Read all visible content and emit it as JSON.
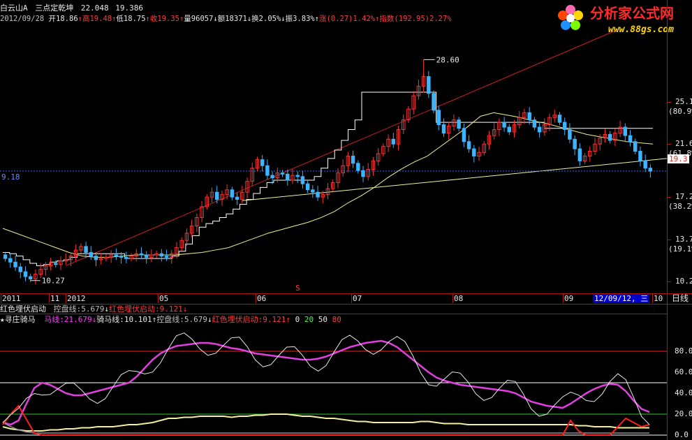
{
  "stock": {
    "name": "白云山A",
    "formula": "三点定乾坤",
    "v1": "22.048",
    "v2": "19.386"
  },
  "quote": {
    "date": "2012/09/28",
    "open": "开18.86",
    "high": "高19.48",
    "low": "低18.75",
    "close": "收19.35",
    "vol": "量96057",
    "amt": "额18371",
    "turn": "换2.05%",
    "amp": "振3.83%",
    "chg": "涨(0.27)1.42%",
    "idx": "指数(192.95)2.27%"
  },
  "annotations": {
    "peak": "28.60",
    "trough": "10.27",
    "hline": "9.18",
    "price_tag": "19.3",
    "signal": "S"
  },
  "price_axis": [
    {
      "v": "25.1",
      "p": "(80.9%)"
    },
    {
      "v": "21.6",
      "p": "(61.8%)"
    },
    {
      "v": "17.2",
      "p": "(38.2%)"
    },
    {
      "v": "13.7",
      "p": "(19.1%)"
    },
    {
      "v": "10.2",
      "p": ""
    }
  ],
  "time_axis": [
    "2011",
    "11",
    "2012",
    "05",
    "06",
    "07",
    "08",
    "09",
    "10"
  ],
  "cursor_date": "12/09/12, 三",
  "period": "日线",
  "panel1_legend": {
    "a": "红色埋伏启动",
    "b": "控盘线:5.679",
    "c": "红色埋伏启动:9.121"
  },
  "panel2_legend": {
    "star": "★",
    "title": "寻庄骑马",
    "ma": "马线:21.679",
    "ride": "骑马线:10.101",
    "ctrl": "控盘线:5.679",
    "ambush": "红色埋伏启动:9.121",
    "l0": "0",
    "l20": "20",
    "l50": "50",
    "l80": "80"
  },
  "osc_axis": [
    "80.0",
    "60.0",
    "40.0",
    "20.0",
    "0.0"
  ],
  "logo": {
    "text": "分析家公式网",
    "url": "www.88gs.com"
  },
  "colors": {
    "up": "#ff3232",
    "down": "#3cb4ff",
    "bg": "#000000",
    "axis": "#b01414"
  },
  "chart_data": [
    {
      "type": "candlestick",
      "title": "白云山A",
      "ylim": [
        9.5,
        31.0
      ],
      "y_ticks": [
        25.1,
        21.6,
        17.2,
        13.7,
        10.2
      ],
      "x_ticks": [
        "2011",
        "11",
        "2012",
        "05",
        "06",
        "07",
        "08",
        "09",
        "10"
      ],
      "high_mark": 28.6,
      "low_mark": 10.27,
      "last_close": 19.35,
      "closes": [
        12.1,
        11.8,
        11.4,
        11.0,
        10.6,
        10.4,
        10.8,
        11.2,
        11.5,
        11.7,
        11.6,
        11.9,
        12.0,
        12.3,
        12.8,
        13.1,
        12.6,
        12.3,
        12.0,
        12.1,
        12.2,
        12.4,
        12.3,
        12.2,
        12.1,
        12.3,
        12.5,
        12.4,
        12.2,
        12.4,
        12.5,
        12.3,
        12.2,
        12.5,
        13.0,
        13.6,
        14.2,
        14.8,
        15.5,
        16.4,
        17.2,
        17.6,
        17.0,
        17.4,
        17.8,
        17.2,
        17.0,
        17.6,
        18.5,
        19.6,
        20.3,
        19.8,
        19.0,
        18.8,
        19.2,
        19.1,
        18.6,
        19.0,
        18.9,
        18.3,
        17.8,
        17.6,
        17.2,
        17.4,
        17.9,
        18.4,
        19.2,
        19.8,
        20.6,
        20.0,
        19.4,
        18.9,
        19.5,
        20.2,
        20.8,
        21.4,
        22.0,
        21.6,
        22.8,
        23.6,
        24.5,
        25.6,
        26.4,
        27.2,
        25.8,
        24.4,
        23.2,
        22.5,
        23.1,
        23.6,
        22.9,
        21.8,
        21.2,
        20.6,
        20.9,
        21.6,
        22.3,
        22.8,
        23.4,
        23.0,
        22.6,
        23.2,
        23.8,
        24.2,
        23.6,
        23.0,
        22.6,
        23.2,
        23.8,
        24.0,
        23.4,
        22.8,
        22.0,
        21.2,
        20.2,
        20.6,
        21.0,
        21.6,
        22.1,
        22.4,
        21.9,
        22.5,
        23.0,
        22.3,
        21.8,
        21.0,
        20.2,
        19.6,
        19.35
      ],
      "series": [
        {
          "name": "控盘线",
          "values": [
            12.6,
            12.5,
            12.3,
            12.0,
            11.7,
            11.5,
            11.6,
            11.8,
            11.9,
            12.0,
            12.2,
            12.5,
            12.5,
            12.5,
            12.5,
            12.5,
            12.5,
            12.5,
            12.1,
            12.1,
            12.1,
            12.1,
            12.1,
            12.1,
            12.1,
            12.3,
            12.7,
            13.3,
            14.0,
            14.7,
            15.0,
            15.2,
            15.5,
            15.8,
            16.2,
            16.6,
            17.0,
            17.5,
            18.0,
            18.4,
            18.6,
            18.6,
            18.6,
            18.6,
            18.6,
            18.6,
            18.9,
            19.6,
            20.4,
            21.1,
            21.9,
            22.8,
            23.6,
            25.9,
            25.9,
            25.9,
            25.9,
            25.9,
            25.9,
            25.9,
            25.9,
            25.9,
            25.9,
            25.9,
            23.4,
            23.4,
            23.4,
            23.4,
            23.4,
            23.4,
            23.4,
            23.4,
            23.4,
            23.4,
            23.4,
            23.4,
            23.4,
            23.4,
            23.4,
            23.4,
            22.9,
            22.9,
            22.9,
            22.9,
            22.9,
            22.9,
            22.9,
            22.9,
            22.9,
            22.9,
            22.9,
            22.9,
            22.9,
            22.9,
            22.9,
            22.9
          ]
        },
        {
          "name": "骑马线",
          "values": [
            14.6,
            14.2,
            13.8,
            13.4,
            13.0,
            12.6,
            12.3,
            12.2,
            12.2,
            12.3,
            12.4,
            12.4,
            12.4,
            12.4,
            12.5,
            12.6,
            12.8,
            13.0,
            13.4,
            13.8,
            14.2,
            14.5,
            14.8,
            15.1,
            15.5,
            16.0,
            16.7,
            17.3,
            18.0,
            18.8,
            19.5,
            20.1,
            20.6,
            21.4,
            22.2,
            23.0,
            23.9,
            24.2,
            24.0,
            23.8,
            23.5,
            23.3,
            23.0,
            22.7,
            22.4,
            22.2,
            22.0,
            21.8,
            21.7,
            21.6
          ]
        },
        {
          "name": "upper_trend",
          "values": [
            [
              11.5,
              31.0
            ]
          ]
        },
        {
          "name": "lower_trend",
          "values": [
            [
              16.9,
              20.4
            ]
          ]
        }
      ]
    },
    {
      "type": "line",
      "title": "寻庄骑马",
      "ylim": [
        0,
        100
      ],
      "y_ticks": [
        80,
        60,
        40,
        20,
        0
      ],
      "reference_lines": [
        0,
        20,
        50,
        80
      ],
      "series": [
        {
          "name": "马线",
          "values": [
            12,
            10,
            14,
            30,
            45,
            50,
            48,
            44,
            40,
            38,
            38,
            40,
            42,
            44,
            46,
            48,
            50,
            56,
            64,
            72,
            78,
            82,
            85,
            86,
            87,
            88,
            88,
            87,
            85,
            83,
            82,
            80,
            78,
            77,
            76,
            75,
            74,
            73,
            72,
            72,
            73,
            75,
            78,
            81,
            84,
            86,
            88,
            89,
            90,
            88,
            84,
            78,
            72,
            66,
            60,
            55,
            52,
            50,
            48,
            47,
            46,
            45,
            44,
            43,
            42,
            40,
            36,
            32,
            30,
            28,
            27,
            26,
            30,
            35,
            40,
            44,
            47,
            49,
            48,
            42,
            33,
            25,
            22
          ]
        },
        {
          "name": "骑马线",
          "values": [
            8,
            6,
            5,
            4,
            4,
            4,
            5,
            5,
            6,
            6,
            7,
            7,
            8,
            8,
            8,
            9,
            10,
            10,
            11,
            12,
            14,
            16,
            16,
            17,
            17,
            18,
            18,
            18,
            18,
            17,
            18,
            18,
            19,
            19,
            20,
            20,
            20,
            19,
            18,
            18,
            17,
            16,
            16,
            15,
            14,
            13,
            13,
            12,
            12,
            12,
            12,
            12,
            12,
            13,
            13,
            12,
            11,
            11,
            11,
            10,
            10,
            10,
            10,
            10,
            10,
            10,
            10,
            10,
            10,
            10,
            10,
            10,
            10,
            9,
            9,
            8,
            8,
            8,
            7,
            7,
            7,
            7,
            7
          ]
        },
        {
          "name": "控盘线",
          "values": [
            12,
            8,
            5,
            3,
            2,
            2,
            2,
            2,
            2,
            2,
            2,
            2,
            2,
            2,
            2,
            2,
            2,
            2,
            2,
            2,
            2,
            2,
            2,
            2,
            2,
            2,
            2,
            2,
            2,
            2,
            2,
            2,
            2,
            2,
            2,
            2,
            2,
            2,
            2,
            2,
            2,
            2,
            2,
            2,
            2,
            2,
            2,
            2,
            2,
            2,
            2,
            2,
            2,
            2,
            2,
            2,
            2,
            2,
            2,
            2,
            2,
            2,
            2,
            2,
            2,
            2,
            2,
            2,
            2,
            2,
            2,
            2,
            2,
            2,
            2,
            2,
            2,
            2,
            2,
            2,
            2,
            2,
            2
          ]
        },
        {
          "name": "红色埋伏启动",
          "values": [
            10,
            20,
            28,
            15,
            2,
            0,
            0,
            0,
            0,
            0,
            0,
            0,
            0,
            0,
            0,
            0,
            0,
            0,
            0,
            0,
            0,
            0,
            0,
            0,
            0,
            0,
            0,
            0,
            0,
            0,
            0,
            0,
            0,
            0,
            0,
            0,
            0,
            0,
            0,
            0,
            0,
            0,
            0,
            0,
            0,
            0,
            0,
            0,
            0,
            0,
            0,
            0,
            0,
            0,
            0,
            0,
            0,
            0,
            0,
            0,
            0,
            0,
            0,
            0,
            0,
            0,
            0,
            0,
            0,
            0,
            0,
            0,
            14,
            4,
            0,
            0,
            0,
            0,
            8,
            16,
            12,
            8,
            10
          ]
        }
      ]
    }
  ]
}
